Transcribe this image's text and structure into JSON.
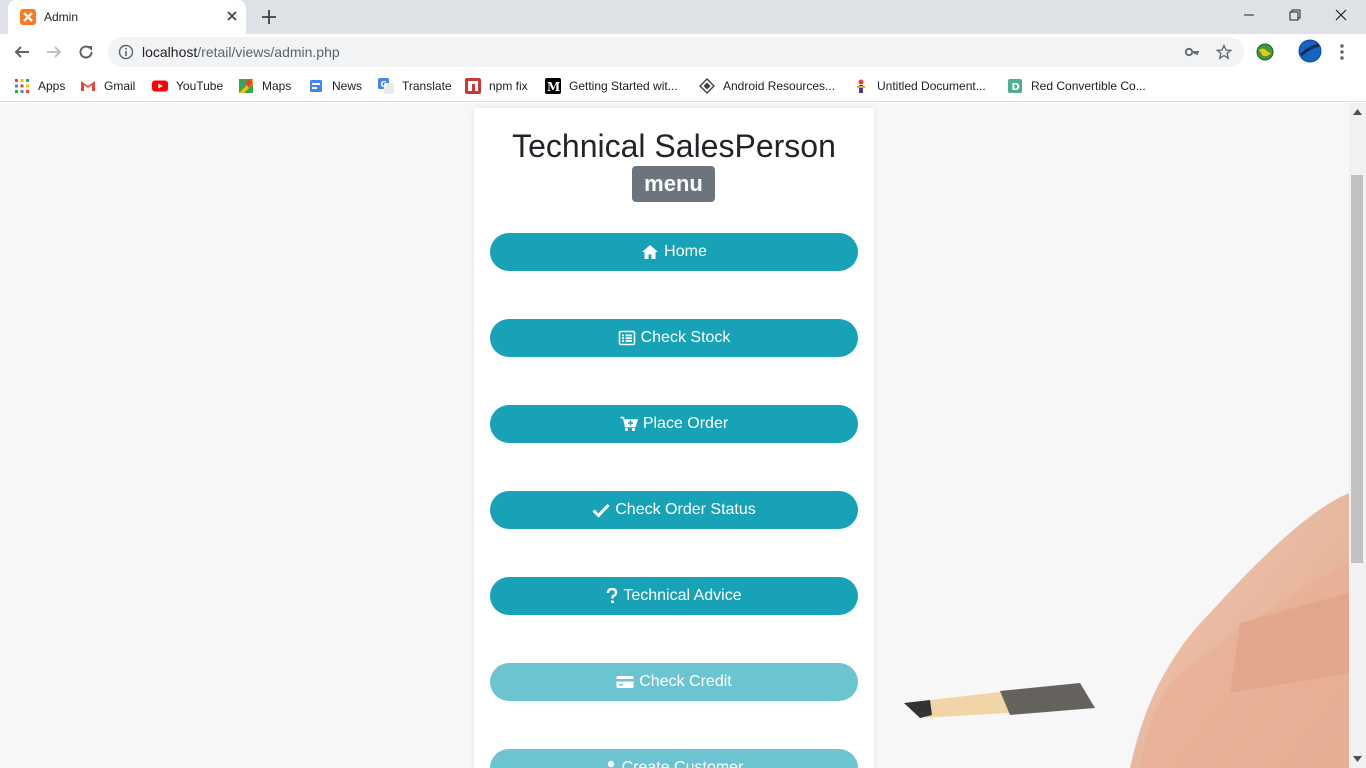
{
  "browser": {
    "tab_title": "Admin",
    "url_host": "localhost",
    "url_path": "/retail/views/admin.php",
    "bookmarks": [
      {
        "label": "Apps",
        "icon": "apps-grid-icon"
      },
      {
        "label": "Gmail",
        "icon": "gmail-icon"
      },
      {
        "label": "YouTube",
        "icon": "youtube-icon"
      },
      {
        "label": "Maps",
        "icon": "maps-icon"
      },
      {
        "label": "News",
        "icon": "news-icon"
      },
      {
        "label": "Translate",
        "icon": "translate-icon"
      },
      {
        "label": "npm fix",
        "icon": "npm-icon"
      },
      {
        "label": "Getting Started wit...",
        "icon": "medium-icon"
      },
      {
        "label": "Android Resources...",
        "icon": "android-resources-icon"
      },
      {
        "label": "Untitled Document...",
        "icon": "document-icon"
      },
      {
        "label": "Red Convertible Co...",
        "icon": "d-icon"
      }
    ]
  },
  "card": {
    "title": "Technical SalesPerson",
    "badge": "menu",
    "buttons": [
      {
        "label": "Home",
        "icon": "home-icon",
        "state": "active"
      },
      {
        "label": "Check Stock",
        "icon": "list-icon",
        "state": "active"
      },
      {
        "label": "Place Order",
        "icon": "cart-icon",
        "state": "active"
      },
      {
        "label": "Check Order Status",
        "icon": "check-icon",
        "state": "active"
      },
      {
        "label": "Technical Advice",
        "icon": "question-icon",
        "state": "active"
      },
      {
        "label": "Check Credit",
        "icon": "credit-card-icon",
        "state": "faded"
      },
      {
        "label": "Create Customer",
        "icon": "user-icon",
        "state": "faded"
      }
    ]
  },
  "colors": {
    "button": "#17a2b8",
    "button_faded": "#6cc4d1",
    "badge": "#6c757d",
    "tab_strip": "#dee1e6"
  }
}
